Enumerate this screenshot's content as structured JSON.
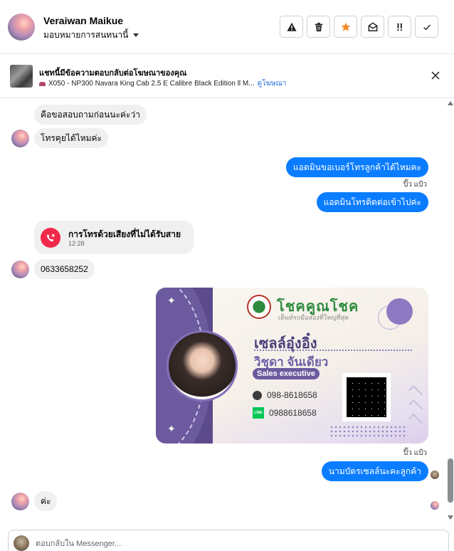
{
  "header": {
    "contact_name": "Veraiwan Maikue",
    "assign_label": "มอบหมายการสนทนานี้",
    "actions": [
      {
        "icon": "warning-icon",
        "label": "Report"
      },
      {
        "icon": "trash-icon",
        "label": "Delete"
      },
      {
        "icon": "star-icon",
        "label": "Star"
      },
      {
        "icon": "mark-unread-icon",
        "label": "Mark as unread"
      },
      {
        "icon": "follow-up-icon",
        "label": "Follow up"
      },
      {
        "icon": "check-icon",
        "label": "Done"
      }
    ],
    "star_color": "#f28c28"
  },
  "ad_banner": {
    "title": "แชทนี้มีข้อความตอบกลับต่อโฆษณาของคุณ",
    "product": "X050 - NP300 Navara King Cab 2.5 E Calibre Black Edition ll M...",
    "link": "ดูโฆษณา"
  },
  "messages": {
    "in_1": "คือขอสอบถามก่อนนะค่ะว่า",
    "in_2": "โทรคุยได้ไหมค่ะ",
    "out_1": "แอดมินขอเบอร์โทรลูกค้าได้ไหมคะ",
    "seen_1": "ปิ๊ว แป้ว",
    "out_2": "แอดมินโทรติดต่อเข้าไปค่ะ",
    "missed_call_title": "การโทรด้วยเสียงที่ไม่ได้รับสาย",
    "missed_call_time": "12:28",
    "in_3": "0633658252",
    "seen_2": "ปิ๊ว แป้ว",
    "out_3": "นามบัตรเซลล์นะคะลูกค้า",
    "in_4": "ค่ะ"
  },
  "business_card": {
    "brand": "โชคคูณโชค",
    "tagline": "เต็นท์รถมือสองที่ใหญ่ที่สุด",
    "nickname": "เซลล์อุ๋งอิ๋ง",
    "full_name": "วิชุดา จันเดียว",
    "role": "Sales executive",
    "phone": "098-8618658",
    "line_label": "LINE",
    "line_id": "0988618658",
    "accent_color": "#6b5a9e"
  },
  "composer": {
    "placeholder": "ตอบกลับใน Messenger..."
  },
  "colors": {
    "outgoing_bubble": "#0a7cff",
    "incoming_bubble": "#f0f0f0",
    "missed_call": "#f0284a"
  }
}
